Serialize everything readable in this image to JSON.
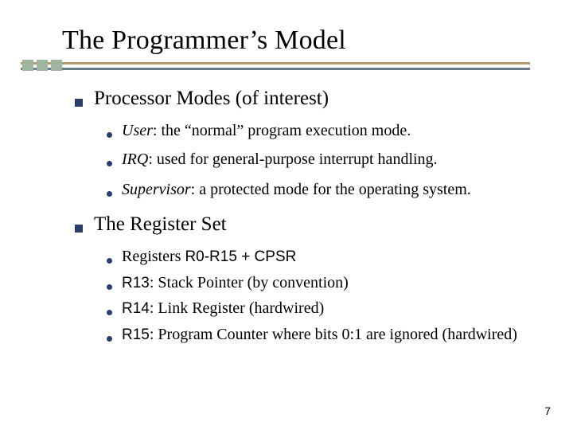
{
  "title": "The Programmer’s Model",
  "sections": [
    {
      "heading": "Processor Modes (of interest)",
      "items": [
        {
          "lead": "User",
          "rest": ": the “normal” program execution mode."
        },
        {
          "lead": "IRQ",
          "rest": ": used for general-purpose interrupt handling."
        },
        {
          "lead": "Supervisor",
          "rest": ": a protected mode for the operating system."
        }
      ]
    },
    {
      "heading": "The Register Set",
      "items": [
        {
          "plain_pre": "Registers ",
          "mix": "R0-R15 + CPSR"
        },
        {
          "mix_lead": "R13",
          "rest": ": Stack Pointer (by convention)"
        },
        {
          "mix_lead": "R14",
          "rest": ": Link Register (hardwired)"
        },
        {
          "mix_lead": "R15",
          "rest": ": Program Counter where bits 0:1 are ignored (hardwired)"
        }
      ]
    }
  ],
  "page_number": "7"
}
